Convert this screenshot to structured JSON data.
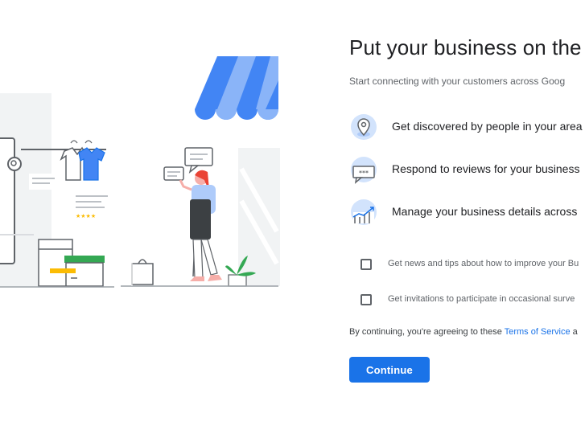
{
  "header": {
    "title": "Put your business on the m",
    "subtitle": "Start connecting with your customers across Goog"
  },
  "features": [
    {
      "icon": "location-pin-icon",
      "label": "Get discovered by people in your area"
    },
    {
      "icon": "review-chat-icon",
      "label": "Respond to reviews for your business"
    },
    {
      "icon": "business-chart-icon",
      "label": "Manage your business details across"
    }
  ],
  "options": [
    {
      "label": "Get news and tips about how to improve your Bu",
      "checked": false
    },
    {
      "label": "Get invitations to participate in occasional surve",
      "checked": false
    }
  ],
  "terms": {
    "prefix": "By continuing, you're agreeing to these ",
    "link": "Terms of Service",
    "suffix": " a"
  },
  "continue_label": "Continue",
  "colors": {
    "accent": "#1a73e8",
    "awning_light": "#8ab4f8",
    "awning_dark": "#4285f4",
    "shelf_green": "#34a853",
    "shelf_yellow": "#fbbc04",
    "icon_circle": "#d2e3fc"
  }
}
